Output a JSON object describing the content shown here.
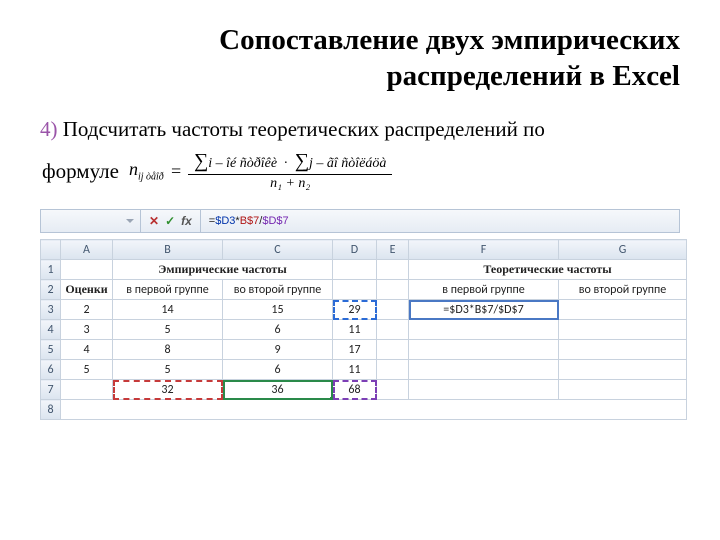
{
  "title_line1": "Сопоставление двух эмпирических",
  "title_line2": "распределений в Excel",
  "step_num": "4)",
  "step_text": " Подсчитать частоты теоретических распределений по",
  "formula_label": "формуле",
  "formula": {
    "lhs_n": "n",
    "lhs_sub": "ij òåîð",
    "eq": "=",
    "top_i": "i – îé ñòðîêè",
    "top_j": "j – ãî ñòîëáöà",
    "bot": "n₁ + n₂"
  },
  "formula_bar": {
    "cancel": "✕",
    "accept": "✓",
    "fx": "fx",
    "eq": "=",
    "ref1": "$D3",
    "op1": "*",
    "ref2": "B$7",
    "op2": "/",
    "ref3": "$D$7"
  },
  "columns": [
    "",
    "A",
    "B",
    "C",
    "D",
    "E",
    "F",
    "G"
  ],
  "rows": {
    "r1": {
      "n": "1",
      "A": "",
      "BC": "Эмпирические частоты",
      "D": "",
      "E": "",
      "FG": "Теоретические частоты"
    },
    "r2": {
      "n": "2",
      "A": "Оценки",
      "B": "в первой группе",
      "C": "во второй группе",
      "D": "",
      "E": "",
      "F": "в первой группе",
      "G": "во второй группе"
    },
    "r3": {
      "n": "3",
      "A": "2",
      "B": "14",
      "C": "15",
      "D": "29",
      "E": "",
      "F": "=$D3*B$7/$D$7",
      "G": ""
    },
    "r4": {
      "n": "4",
      "A": "3",
      "B": "5",
      "C": "6",
      "D": "11",
      "E": "",
      "F": "",
      "G": ""
    },
    "r5": {
      "n": "5",
      "A": "4",
      "B": "8",
      "C": "9",
      "D": "17",
      "E": "",
      "F": "",
      "G": ""
    },
    "r6": {
      "n": "6",
      "A": "5",
      "B": "5",
      "C": "6",
      "D": "11",
      "E": "",
      "F": "",
      "G": ""
    },
    "r7": {
      "n": "7",
      "A": "",
      "B": "32",
      "C": "36",
      "D": "68",
      "E": "",
      "F": "",
      "G": ""
    },
    "r8": {
      "n": "8"
    }
  }
}
